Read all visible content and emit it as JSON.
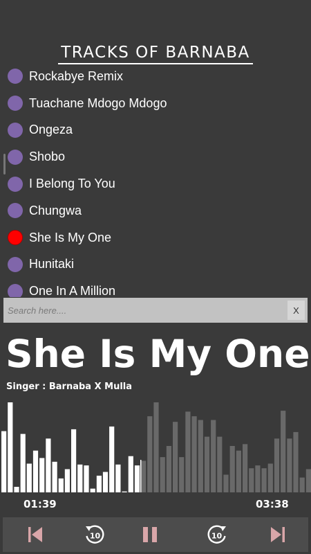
{
  "header": {
    "title": "TRACKS OF BARNABA"
  },
  "tracks": [
    {
      "label": "Rockabye Remix",
      "active": false
    },
    {
      "label": "Tuachane Mdogo Mdogo",
      "active": false
    },
    {
      "label": "Ongeza",
      "active": false
    },
    {
      "label": "Shobo",
      "active": false
    },
    {
      "label": "I Belong To You",
      "active": false
    },
    {
      "label": "Chungwa",
      "active": false
    },
    {
      "label": "She Is My One",
      "active": true
    },
    {
      "label": "Hunitaki",
      "active": false
    },
    {
      "label": "One In A Million",
      "active": false
    }
  ],
  "search": {
    "placeholder": "Search here....",
    "clear_label": "X"
  },
  "now_playing": {
    "title": "She Is My One",
    "singer": "Singer : Barnaba X Mulla",
    "current_time": "01:39",
    "total_time": "03:38",
    "progress": 0.455
  },
  "waveform": {
    "levels": [
      0.66,
      0.97,
      0.06,
      0.63,
      0.31,
      0.45,
      0.37,
      0.58,
      0.33,
      0.15,
      0.25,
      0.68,
      0.3,
      0.29,
      0.04,
      0.18,
      0.22,
      0.71,
      0.3,
      0.01,
      0.39,
      0.29,
      0.34,
      0.82,
      0.97,
      0.38,
      0.5,
      0.76,
      0.38,
      0.87,
      0.82,
      0.78,
      0.6,
      0.78,
      0.6,
      0.19,
      0.5,
      0.45,
      0.52,
      0.26,
      0.29,
      0.26,
      0.31,
      0.58,
      0.88,
      0.58,
      0.65,
      0.16,
      0.25
    ],
    "played_color": "#ffffff",
    "unplayed_color": "#696969"
  },
  "controls": {
    "previous_icon": "skip-previous-icon",
    "rewind_icon": "replay-10-icon",
    "rewind_seconds": "10",
    "pause_icon": "pause-icon",
    "forward_icon": "forward-10-icon",
    "forward_seconds": "10",
    "next_icon": "skip-next-icon",
    "accent_color": "#d9a6a9"
  },
  "colors": {
    "background": "#3a3a3a",
    "track_dot": "#8066aa",
    "track_dot_active": "#ff0000"
  }
}
